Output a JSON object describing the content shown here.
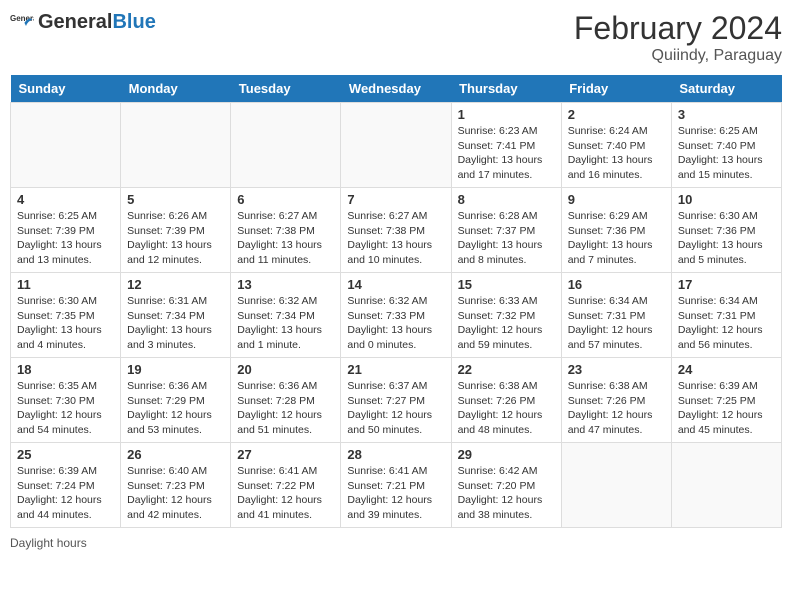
{
  "header": {
    "logo_general": "General",
    "logo_blue": "Blue",
    "month_title": "February 2024",
    "location": "Quiindy, Paraguay"
  },
  "weekdays": [
    "Sunday",
    "Monday",
    "Tuesday",
    "Wednesday",
    "Thursday",
    "Friday",
    "Saturday"
  ],
  "weeks": [
    [
      {
        "day": "",
        "info": ""
      },
      {
        "day": "",
        "info": ""
      },
      {
        "day": "",
        "info": ""
      },
      {
        "day": "",
        "info": ""
      },
      {
        "day": "1",
        "info": "Sunrise: 6:23 AM\nSunset: 7:41 PM\nDaylight: 13 hours and 17 minutes."
      },
      {
        "day": "2",
        "info": "Sunrise: 6:24 AM\nSunset: 7:40 PM\nDaylight: 13 hours and 16 minutes."
      },
      {
        "day": "3",
        "info": "Sunrise: 6:25 AM\nSunset: 7:40 PM\nDaylight: 13 hours and 15 minutes."
      }
    ],
    [
      {
        "day": "4",
        "info": "Sunrise: 6:25 AM\nSunset: 7:39 PM\nDaylight: 13 hours and 13 minutes."
      },
      {
        "day": "5",
        "info": "Sunrise: 6:26 AM\nSunset: 7:39 PM\nDaylight: 13 hours and 12 minutes."
      },
      {
        "day": "6",
        "info": "Sunrise: 6:27 AM\nSunset: 7:38 PM\nDaylight: 13 hours and 11 minutes."
      },
      {
        "day": "7",
        "info": "Sunrise: 6:27 AM\nSunset: 7:38 PM\nDaylight: 13 hours and 10 minutes."
      },
      {
        "day": "8",
        "info": "Sunrise: 6:28 AM\nSunset: 7:37 PM\nDaylight: 13 hours and 8 minutes."
      },
      {
        "day": "9",
        "info": "Sunrise: 6:29 AM\nSunset: 7:36 PM\nDaylight: 13 hours and 7 minutes."
      },
      {
        "day": "10",
        "info": "Sunrise: 6:30 AM\nSunset: 7:36 PM\nDaylight: 13 hours and 5 minutes."
      }
    ],
    [
      {
        "day": "11",
        "info": "Sunrise: 6:30 AM\nSunset: 7:35 PM\nDaylight: 13 hours and 4 minutes."
      },
      {
        "day": "12",
        "info": "Sunrise: 6:31 AM\nSunset: 7:34 PM\nDaylight: 13 hours and 3 minutes."
      },
      {
        "day": "13",
        "info": "Sunrise: 6:32 AM\nSunset: 7:34 PM\nDaylight: 13 hours and 1 minute."
      },
      {
        "day": "14",
        "info": "Sunrise: 6:32 AM\nSunset: 7:33 PM\nDaylight: 13 hours and 0 minutes."
      },
      {
        "day": "15",
        "info": "Sunrise: 6:33 AM\nSunset: 7:32 PM\nDaylight: 12 hours and 59 minutes."
      },
      {
        "day": "16",
        "info": "Sunrise: 6:34 AM\nSunset: 7:31 PM\nDaylight: 12 hours and 57 minutes."
      },
      {
        "day": "17",
        "info": "Sunrise: 6:34 AM\nSunset: 7:31 PM\nDaylight: 12 hours and 56 minutes."
      }
    ],
    [
      {
        "day": "18",
        "info": "Sunrise: 6:35 AM\nSunset: 7:30 PM\nDaylight: 12 hours and 54 minutes."
      },
      {
        "day": "19",
        "info": "Sunrise: 6:36 AM\nSunset: 7:29 PM\nDaylight: 12 hours and 53 minutes."
      },
      {
        "day": "20",
        "info": "Sunrise: 6:36 AM\nSunset: 7:28 PM\nDaylight: 12 hours and 51 minutes."
      },
      {
        "day": "21",
        "info": "Sunrise: 6:37 AM\nSunset: 7:27 PM\nDaylight: 12 hours and 50 minutes."
      },
      {
        "day": "22",
        "info": "Sunrise: 6:38 AM\nSunset: 7:26 PM\nDaylight: 12 hours and 48 minutes."
      },
      {
        "day": "23",
        "info": "Sunrise: 6:38 AM\nSunset: 7:26 PM\nDaylight: 12 hours and 47 minutes."
      },
      {
        "day": "24",
        "info": "Sunrise: 6:39 AM\nSunset: 7:25 PM\nDaylight: 12 hours and 45 minutes."
      }
    ],
    [
      {
        "day": "25",
        "info": "Sunrise: 6:39 AM\nSunset: 7:24 PM\nDaylight: 12 hours and 44 minutes."
      },
      {
        "day": "26",
        "info": "Sunrise: 6:40 AM\nSunset: 7:23 PM\nDaylight: 12 hours and 42 minutes."
      },
      {
        "day": "27",
        "info": "Sunrise: 6:41 AM\nSunset: 7:22 PM\nDaylight: 12 hours and 41 minutes."
      },
      {
        "day": "28",
        "info": "Sunrise: 6:41 AM\nSunset: 7:21 PM\nDaylight: 12 hours and 39 minutes."
      },
      {
        "day": "29",
        "info": "Sunrise: 6:42 AM\nSunset: 7:20 PM\nDaylight: 12 hours and 38 minutes."
      },
      {
        "day": "",
        "info": ""
      },
      {
        "day": "",
        "info": ""
      }
    ]
  ],
  "footer": {
    "daylight_label": "Daylight hours"
  }
}
